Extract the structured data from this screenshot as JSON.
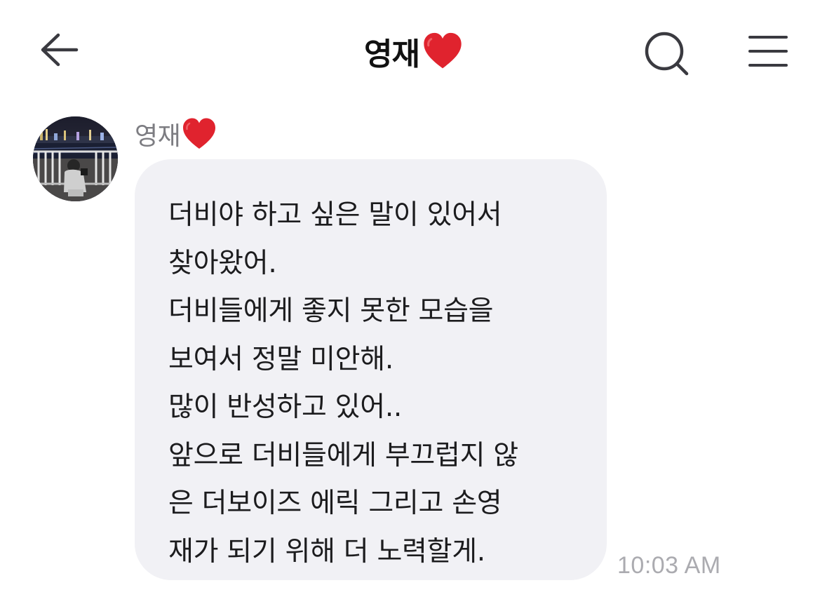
{
  "header": {
    "title": "영재",
    "title_emoji_icon": "red-heart-icon",
    "back_icon": "arrow-left-icon",
    "search_icon": "search-icon",
    "menu_icon": "hamburger-menu-icon"
  },
  "message": {
    "sender_name": "영재",
    "sender_emoji_icon": "red-heart-icon",
    "avatar_icon": "profile-photo-night-river",
    "lines": [
      "더비야 하고 싶은 말이 있어서",
      "찾아왔어.",
      "더비들에게 좋지 못한 모습을",
      "보여서 정말 미안해.",
      "많이 반성하고 있어..",
      "앞으로 더비들에게 부끄럽지 않",
      "은 더보이즈 에릭 그리고 손영",
      "재가 되기 위해 더 노력할게."
    ],
    "time": "10:03 AM"
  },
  "colors": {
    "background": "#ffffff",
    "bubble": "#f1f1f5",
    "text": "#1c1c1e",
    "sender": "#7d7d82",
    "timestamp": "#ababb0",
    "heart": "#e0232e",
    "icon": "#3a3a40"
  }
}
